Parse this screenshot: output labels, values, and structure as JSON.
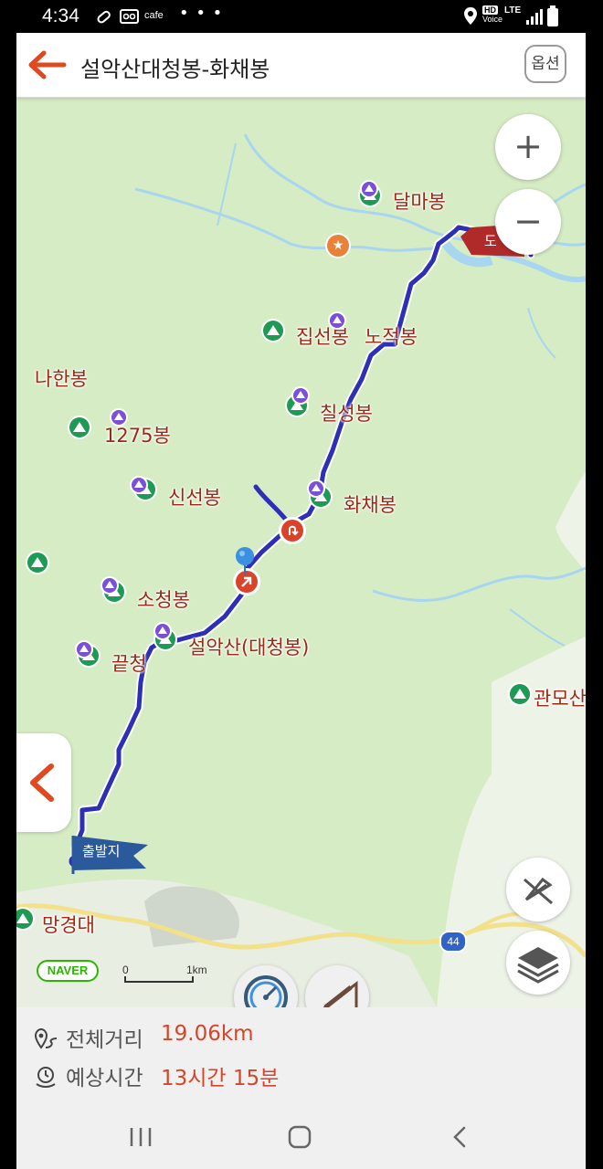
{
  "status_bar": {
    "time": "4:34",
    "cafe_label": "cafe",
    "more_dots": "• • •",
    "network": "LTE",
    "hd_label": "HD",
    "voice_label": "Voice"
  },
  "header": {
    "back_icon": "arrow-left-icon",
    "title": "설악산대청봉-화채봉",
    "options_label": "옵션",
    "accent_color": "#e0481f"
  },
  "map": {
    "peaks": [
      {
        "name": "달마봉"
      },
      {
        "name": "집선봉"
      },
      {
        "name": "노적봉"
      },
      {
        "name": "나한봉"
      },
      {
        "name": "칠성봉"
      },
      {
        "name": "1275봉"
      },
      {
        "name": "신선봉"
      },
      {
        "name": "화채봉"
      },
      {
        "name": "소청봉"
      },
      {
        "name": "설악산(대청봉)"
      },
      {
        "name": "끝청"
      },
      {
        "name": "관모산"
      },
      {
        "name": "망경대"
      }
    ],
    "start_flag": "출발지",
    "end_flag_partial": "도",
    "road_number": "44",
    "zoom_in": "+",
    "zoom_out": "−",
    "naver_logo": "NAVER",
    "scale_start": "0",
    "scale_end": "1km",
    "route_color": "#2d2fb5",
    "map_color": "#d6ecc5",
    "water_color": "#a8d5ef"
  },
  "summary": {
    "distance_label": "전체거리",
    "distance_value": "19.06km",
    "time_label": "예상시간",
    "time_value": "13시간 15분"
  },
  "nav_bar": {
    "recent_icon": "recent-apps-icon",
    "home_icon": "home-icon",
    "back_icon": "back-icon"
  }
}
